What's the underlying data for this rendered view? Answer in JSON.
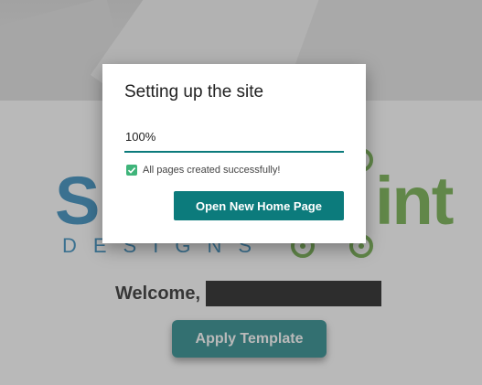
{
  "background": {
    "logo": {
      "word_left": "Sh",
      "word_right": "int",
      "tagline": "DESIGNS",
      "color_blue": "#1b7db5",
      "color_green": "#5fa533"
    },
    "welcome_label": "Welcome,",
    "apply_button_label": "Apply Template"
  },
  "dialog": {
    "title": "Setting up the site",
    "progress_value": "100%",
    "status_text": "All pages created successfully!",
    "primary_button_label": "Open New Home Page"
  },
  "colors": {
    "accent": "#0c7b7c",
    "success": "#3fb47a"
  }
}
